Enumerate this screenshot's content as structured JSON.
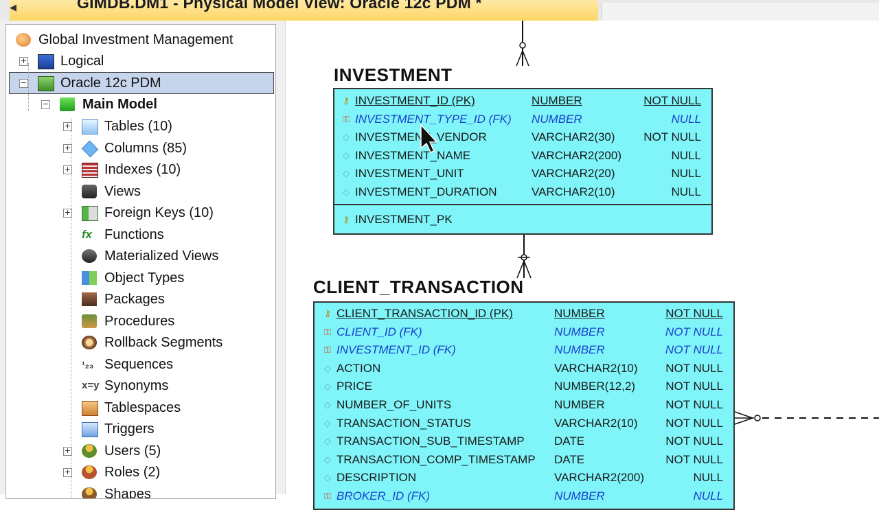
{
  "window": {
    "tab_title": "GIMDB.DM1 - Physical Model View: Oracle 12c PDM *"
  },
  "tree": {
    "root": "Global Investment Management",
    "logical": "Logical",
    "physical": "Oracle 12c PDM",
    "main_model": "Main Model",
    "items": [
      {
        "label": "Tables (10)",
        "icon": "table-icon",
        "expandable": true
      },
      {
        "label": "Columns (85)",
        "icon": "column-icon",
        "expandable": true
      },
      {
        "label": "Indexes (10)",
        "icon": "index-icon",
        "expandable": true
      },
      {
        "label": "Views",
        "icon": "view-icon",
        "expandable": false
      },
      {
        "label": "Foreign Keys (10)",
        "icon": "foreign-key-icon",
        "expandable": true
      },
      {
        "label": "Functions",
        "icon": "function-icon",
        "expandable": false
      },
      {
        "label": "Materialized Views",
        "icon": "materialized-view-icon",
        "expandable": false
      },
      {
        "label": "Object Types",
        "icon": "object-type-icon",
        "expandable": false
      },
      {
        "label": "Packages",
        "icon": "package-icon",
        "expandable": false
      },
      {
        "label": "Procedures",
        "icon": "procedure-icon",
        "expandable": false
      },
      {
        "label": "Rollback Segments",
        "icon": "rollback-segment-icon",
        "expandable": false
      },
      {
        "label": "Sequences",
        "icon": "sequence-icon",
        "expandable": false
      },
      {
        "label": "Synonyms",
        "icon": "synonym-icon",
        "expandable": false
      },
      {
        "label": "Tablespaces",
        "icon": "tablespace-icon",
        "expandable": false
      },
      {
        "label": "Triggers",
        "icon": "trigger-icon",
        "expandable": false
      },
      {
        "label": "Users (5)",
        "icon": "user-icon",
        "expandable": true
      },
      {
        "label": "Roles (2)",
        "icon": "role-icon",
        "expandable": true
      },
      {
        "label": "Shapes",
        "icon": "shape-icon",
        "expandable": false
      }
    ]
  },
  "diagram": {
    "colors": {
      "entity_fill": "#7ff5f9",
      "fk_text": "#1a3fcf",
      "border": "#333333"
    },
    "investment": {
      "name": "INVESTMENT",
      "columns": [
        {
          "name": "INVESTMENT_ID (PK)",
          "type": "NUMBER",
          "nullity": "NOT NULL",
          "kind": "pk"
        },
        {
          "name": "INVESTMENT_TYPE_ID (FK)",
          "type": "NUMBER",
          "nullity": "NULL",
          "kind": "fk"
        },
        {
          "name": "INVESTMENT_VENDOR",
          "type": "VARCHAR2(30)",
          "nullity": "NOT NULL",
          "kind": "col"
        },
        {
          "name": "INVESTMENT_NAME",
          "type": "VARCHAR2(200)",
          "nullity": "NULL",
          "kind": "col"
        },
        {
          "name": "INVESTMENT_UNIT",
          "type": "VARCHAR2(20)",
          "nullity": "NULL",
          "kind": "col"
        },
        {
          "name": "INVESTMENT_DURATION",
          "type": "VARCHAR2(10)",
          "nullity": "NULL",
          "kind": "col"
        }
      ],
      "key": "INVESTMENT_PK"
    },
    "client_transaction": {
      "name": "CLIENT_TRANSACTION",
      "columns": [
        {
          "name": "CLIENT_TRANSACTION_ID (PK)",
          "type": "NUMBER",
          "nullity": "NOT NULL",
          "kind": "pk"
        },
        {
          "name": "CLIENT_ID (FK)",
          "type": "NUMBER",
          "nullity": "NOT NULL",
          "kind": "fk"
        },
        {
          "name": "INVESTMENT_ID (FK)",
          "type": "NUMBER",
          "nullity": "NOT NULL",
          "kind": "fk"
        },
        {
          "name": "ACTION",
          "type": "VARCHAR2(10)",
          "nullity": "NOT NULL",
          "kind": "col"
        },
        {
          "name": "PRICE",
          "type": "NUMBER(12,2)",
          "nullity": "NOT NULL",
          "kind": "col"
        },
        {
          "name": "NUMBER_OF_UNITS",
          "type": "NUMBER",
          "nullity": "NOT NULL",
          "kind": "col"
        },
        {
          "name": "TRANSACTION_STATUS",
          "type": "VARCHAR2(10)",
          "nullity": "NOT NULL",
          "kind": "col"
        },
        {
          "name": "TRANSACTION_SUB_TIMESTAMP",
          "type": "DATE",
          "nullity": "NOT NULL",
          "kind": "col"
        },
        {
          "name": "TRANSACTION_COMP_TIMESTAMP",
          "type": "DATE",
          "nullity": "NOT NULL",
          "kind": "col"
        },
        {
          "name": "DESCRIPTION",
          "type": "VARCHAR2(200)",
          "nullity": "NULL",
          "kind": "col"
        },
        {
          "name": "BROKER_ID (FK)",
          "type": "NUMBER",
          "nullity": "NULL",
          "kind": "fk"
        }
      ]
    }
  }
}
